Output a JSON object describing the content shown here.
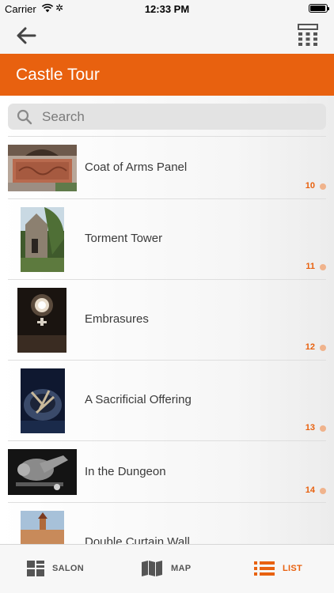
{
  "status_bar": {
    "carrier": "Carrier",
    "time": "12:33 PM"
  },
  "nav": {
    "back_icon": "arrow-left-icon",
    "calculator_icon": "calculator-icon"
  },
  "header": {
    "title": "Castle Tour"
  },
  "search": {
    "placeholder": "Search"
  },
  "items": [
    {
      "label": "Coat of Arms Panel",
      "number": "10"
    },
    {
      "label": "Torment Tower",
      "number": "11"
    },
    {
      "label": "Embrasures",
      "number": "12"
    },
    {
      "label": "A Sacrificial Offering",
      "number": "13"
    },
    {
      "label": "In the Dungeon",
      "number": "14"
    },
    {
      "label": "Double Curtain Wall",
      "number": ""
    }
  ],
  "tabs": [
    {
      "label": "SALON",
      "icon": "grid-icon",
      "active": false
    },
    {
      "label": "MAP",
      "icon": "map-icon",
      "active": false
    },
    {
      "label": "LIST",
      "icon": "list-icon",
      "active": true
    }
  ],
  "colors": {
    "accent": "#e8610f",
    "tab_inactive": "#555555"
  }
}
